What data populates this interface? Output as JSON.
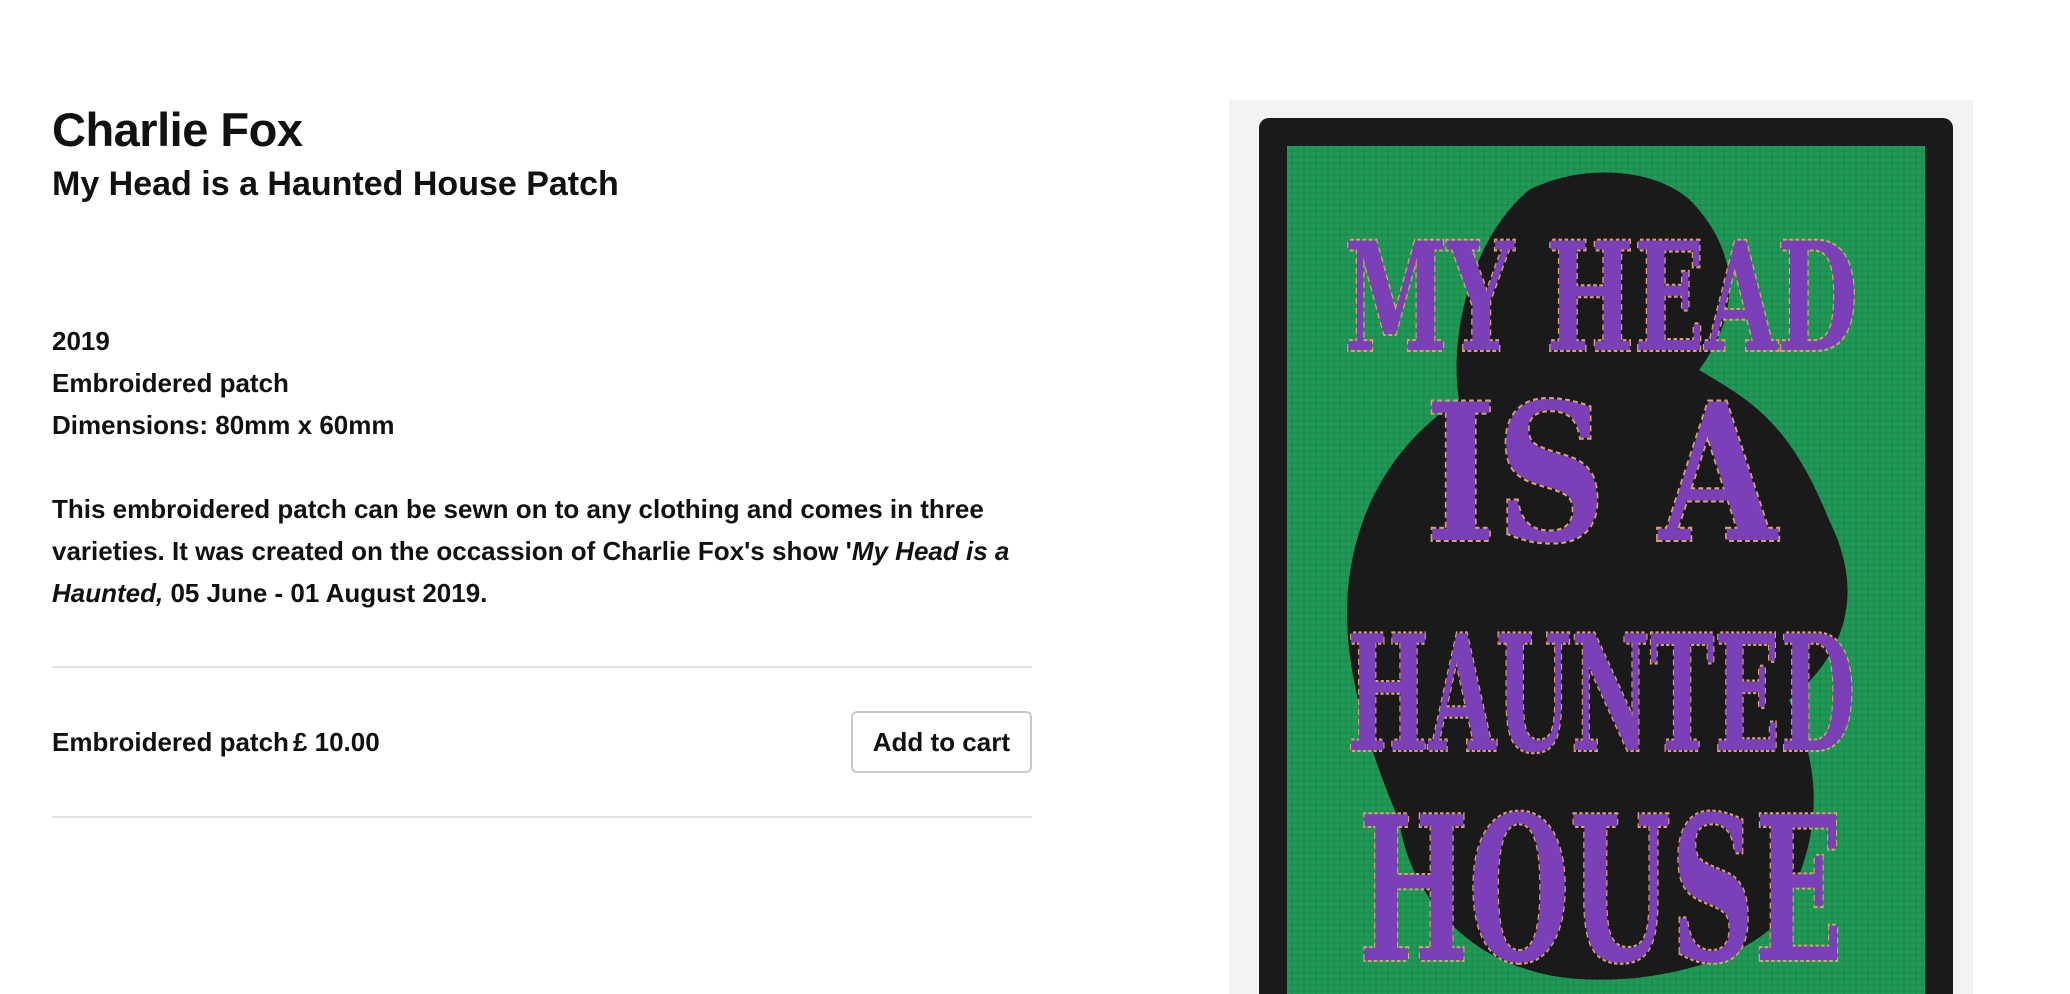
{
  "product": {
    "artist": "Charlie Fox",
    "title": "My Head is a Haunted House Patch",
    "year": "2019",
    "medium": "Embroidered patch",
    "dimensions": "Dimensions: 80mm x 60mm",
    "description_part1": "This embroidered patch can be sewn on to any clothing and comes in three varieties. It was created on the occassion of Charlie Fox's show '",
    "description_italic": "My Head is a Haunted,",
    "description_part2": " 05 June - 01 August 2019."
  },
  "purchase": {
    "variant_label": "Embroidered patch",
    "price": "£ 10.00",
    "add_to_cart_label": "Add to cart"
  },
  "image": {
    "subject": "embroidered-patch-photo",
    "patch_lines": [
      "MY HEAD",
      "IS A",
      "HAUNTED",
      "HOUSE"
    ],
    "colors": {
      "patch_green": "#1f9a57",
      "border_black": "#1a1a1a",
      "lettering_purple": "#7b3fb8",
      "stitch_tan": "#d9a46a"
    }
  }
}
